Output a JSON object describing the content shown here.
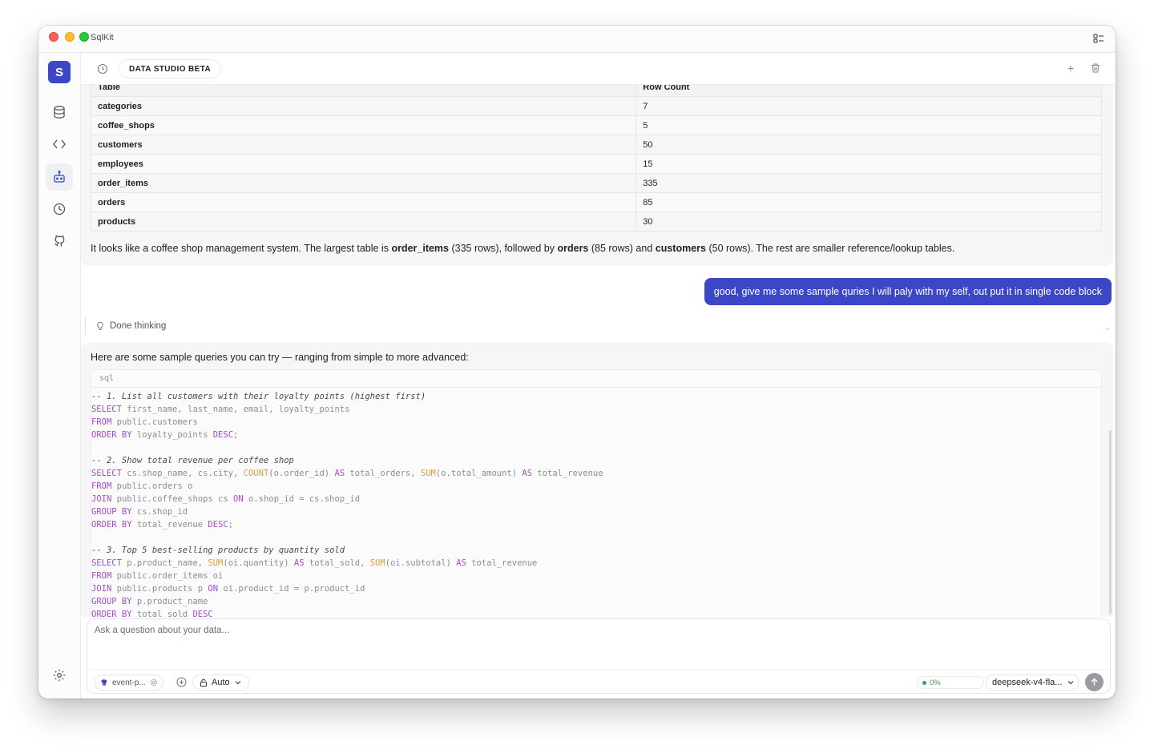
{
  "window": {
    "title": "SqlKit"
  },
  "sidebar": {
    "logo_letter": "S"
  },
  "header": {
    "session_label": "DATA STUDIO BETA",
    "new_label": "+"
  },
  "result_table": {
    "headers": [
      "Table",
      "Row Count"
    ],
    "rows": [
      [
        "categories",
        "7"
      ],
      [
        "coffee_shops",
        "5"
      ],
      [
        "customers",
        "50"
      ],
      [
        "employees",
        "15"
      ],
      [
        "order_items",
        "335"
      ],
      [
        "orders",
        "85"
      ],
      [
        "products",
        "30"
      ]
    ]
  },
  "summary": {
    "t1": "It looks like a coffee shop management system. The largest table is ",
    "b1": "order_items",
    "t2": " (335 rows), followed by ",
    "b2": "orders",
    "t3": " (85 rows) and ",
    "b3": "customers",
    "t4": " (50 rows). The rest are smaller reference/lookup tables."
  },
  "user_message": "good, give me some sample quries I will paly with my self, out put it in single code block",
  "thinking": {
    "label": "Done thinking"
  },
  "assistant_intro": "Here are some sample queries you can try — ranging from simple to more advanced:",
  "code": {
    "language": "sql",
    "lines": [
      [
        [
          "cm",
          "-- 1. List all customers with their loyalty points (highest first)"
        ]
      ],
      [
        [
          "kw",
          "SELECT"
        ],
        [
          "p",
          " first_name, last_name, email, loyalty_points"
        ]
      ],
      [
        [
          "kw",
          "FROM"
        ],
        [
          "p",
          " public.customers"
        ]
      ],
      [
        [
          "kw",
          "ORDER BY"
        ],
        [
          "p",
          " loyalty_points "
        ],
        [
          "kw",
          "DESC"
        ],
        [
          "p",
          ";"
        ]
      ],
      [],
      [
        [
          "cm",
          "-- 2. Show total revenue per coffee shop"
        ]
      ],
      [
        [
          "kw",
          "SELECT"
        ],
        [
          "p",
          " cs.shop_name, cs.city, "
        ],
        [
          "fn",
          "COUNT"
        ],
        [
          "p",
          "(o.order_id) "
        ],
        [
          "kw",
          "AS"
        ],
        [
          "p",
          " total_orders, "
        ],
        [
          "fn",
          "SUM"
        ],
        [
          "p",
          "(o.total_amount) "
        ],
        [
          "kw",
          "AS"
        ],
        [
          "p",
          " total_revenue"
        ]
      ],
      [
        [
          "kw",
          "FROM"
        ],
        [
          "p",
          " public.orders o"
        ]
      ],
      [
        [
          "kw",
          "JOIN"
        ],
        [
          "p",
          " public.coffee_shops cs "
        ],
        [
          "kw",
          "ON"
        ],
        [
          "p",
          " o.shop_id = cs.shop_id"
        ]
      ],
      [
        [
          "kw",
          "GROUP BY"
        ],
        [
          "p",
          " cs.shop_id"
        ]
      ],
      [
        [
          "kw",
          "ORDER BY"
        ],
        [
          "p",
          " total_revenue "
        ],
        [
          "kw",
          "DESC"
        ],
        [
          "p",
          ";"
        ]
      ],
      [],
      [
        [
          "cm",
          "-- 3. Top 5 best-selling products by quantity sold"
        ]
      ],
      [
        [
          "kw",
          "SELECT"
        ],
        [
          "p",
          " p.product_name, "
        ],
        [
          "fn",
          "SUM"
        ],
        [
          "p",
          "(oi.quantity) "
        ],
        [
          "kw",
          "AS"
        ],
        [
          "p",
          " total_sold, "
        ],
        [
          "fn",
          "SUM"
        ],
        [
          "p",
          "(oi.subtotal) "
        ],
        [
          "kw",
          "AS"
        ],
        [
          "p",
          " total_revenue"
        ]
      ],
      [
        [
          "kw",
          "FROM"
        ],
        [
          "p",
          " public.order_items oi"
        ]
      ],
      [
        [
          "kw",
          "JOIN"
        ],
        [
          "p",
          " public.products p "
        ],
        [
          "kw",
          "ON"
        ],
        [
          "p",
          " oi.product_id = p.product_id"
        ]
      ],
      [
        [
          "kw",
          "GROUP BY"
        ],
        [
          "p",
          " p.product_name"
        ]
      ],
      [
        [
          "kw",
          "ORDER BY"
        ],
        [
          "p",
          " total_sold "
        ],
        [
          "kw",
          "DESC"
        ]
      ]
    ]
  },
  "composer": {
    "placeholder": "Ask a question about your data...",
    "connection_label": "event-p...",
    "mode_label": "Auto",
    "context_usage": "0%",
    "model_label": "deepseek-v4-fla..."
  },
  "colors": {
    "accent": "#3b47c6",
    "keyword": "#a74cc8",
    "function": "#d6a03a",
    "success": "#3aa34b"
  }
}
